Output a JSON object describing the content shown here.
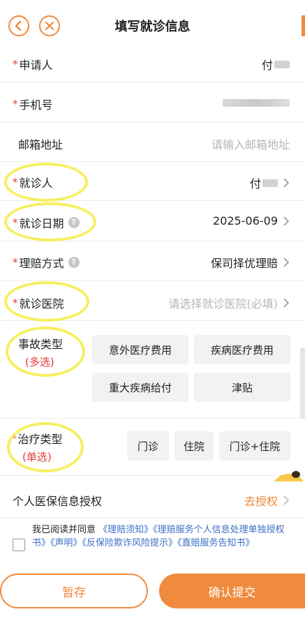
{
  "header": {
    "title": "填写就诊信息"
  },
  "fields": {
    "applicant": {
      "label": "申请人",
      "value": "付"
    },
    "phone": {
      "label": "手机号"
    },
    "email": {
      "label": "邮箱地址",
      "placeholder": "请输入邮箱地址"
    },
    "patient": {
      "label": "就诊人",
      "value": "付"
    },
    "visit_date": {
      "label": "就诊日期",
      "value": "2025-06-09"
    },
    "claim_method": {
      "label": "理赔方式",
      "value": "保司择优理赔"
    },
    "hospital": {
      "label": "就诊医院",
      "placeholder": "请选择就诊医院(必填)"
    }
  },
  "accident_type": {
    "label": "事故类型",
    "sublabel": "(多选)",
    "options": [
      "意外医疗费用",
      "疾病医疗费用",
      "重大疾病给付",
      "津贴"
    ]
  },
  "treatment_type": {
    "label": "治疗类型",
    "sublabel": "(单选)",
    "options": [
      "门诊",
      "住院",
      "门诊+住院"
    ]
  },
  "insurance_auth": {
    "label": "个人医保信息授权",
    "action": "去授权"
  },
  "agreement": {
    "prefix": "我已阅读并同意",
    "links": [
      "《理赔须知》",
      "《理赔服务个人信息处理单独授权书》",
      "《声明》",
      "《反保险欺诈风险提示》",
      "《直赔服务告知书》"
    ]
  },
  "buttons": {
    "save": "暂存",
    "submit": "确认提交"
  },
  "colors": {
    "accent": "#f08a3c",
    "required": "#e53935",
    "link": "#3b6fc6",
    "highlight": "#f6ef62"
  },
  "icons": [
    "back-icon",
    "close-icon",
    "chevron-right-icon",
    "help-icon",
    "mascot-icon"
  ]
}
